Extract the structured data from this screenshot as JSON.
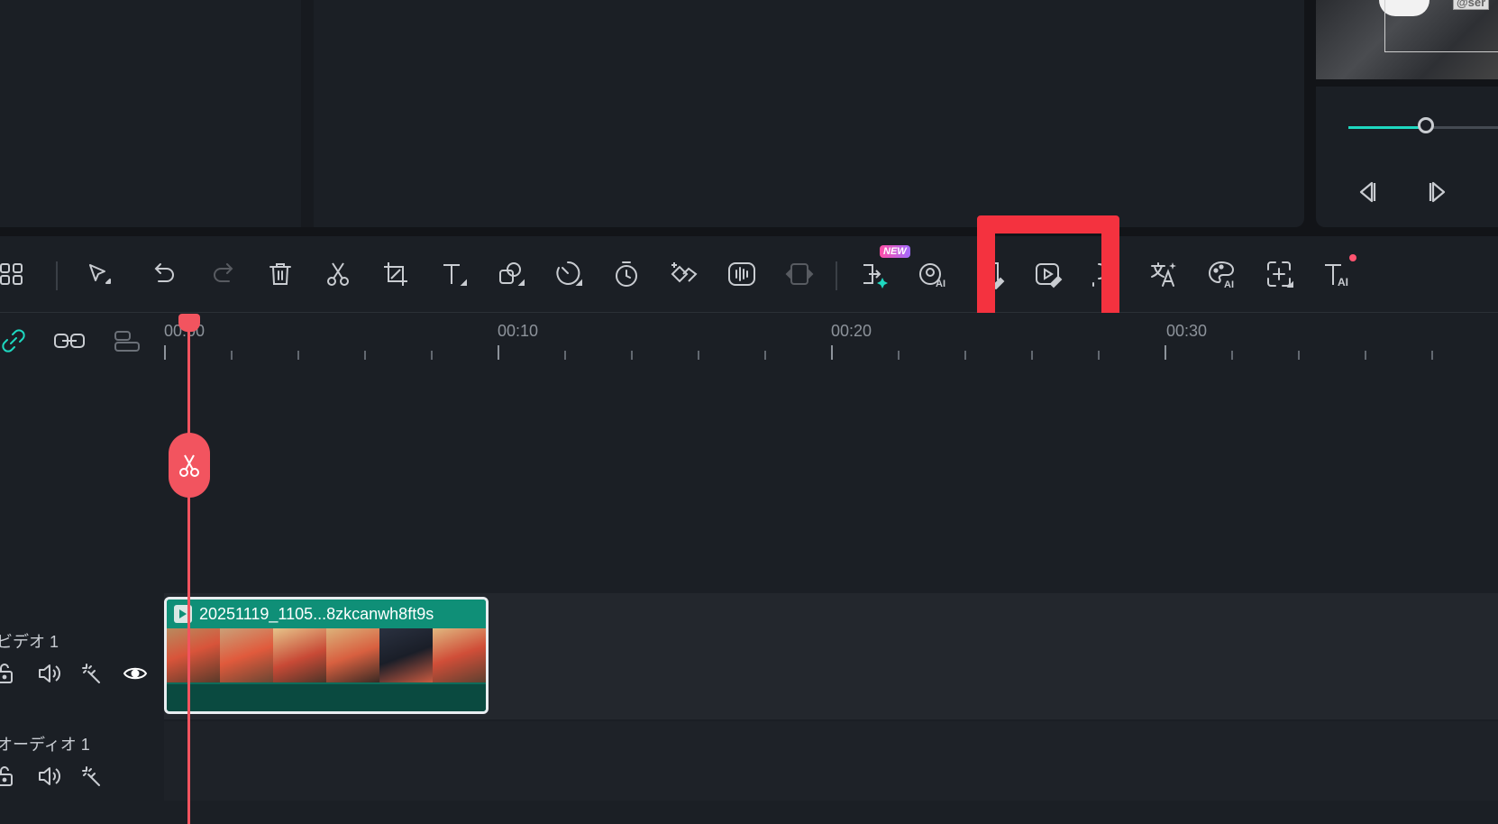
{
  "preview": {
    "watermark": "@ser",
    "slider_level": 0.52
  },
  "toolbar": {
    "new_badge": "NEW",
    "tools": [
      "layout-grid-icon",
      "select-arrow-icon",
      "undo-icon",
      "redo-icon",
      "delete-icon",
      "split-scissors-icon",
      "crop-icon",
      "text-icon",
      "shape-icon",
      "speed-icon",
      "timer-icon",
      "keyframe-icon",
      "audio-waveform-icon",
      "freeze-frame-icon",
      "ai-split-icon",
      "ai-portrait-icon",
      "ai-edit-icon",
      "ai-video-edit-icon",
      "ai-voice-icon",
      "translate-icon",
      "ai-color-palette-icon",
      "add-frame-icon",
      "ai-text-icon"
    ],
    "highlight_color": "#f4323f"
  },
  "timeline": {
    "ruler": [
      "00:00",
      "00:10",
      "00:20",
      "00:30"
    ],
    "tracks": {
      "video_label": "ビデオ 1",
      "audio_label": "オーディオ 1"
    },
    "clip": {
      "title": "20251119_1105...8zkcanwh8ft9s"
    },
    "playhead_color": "#f2545f",
    "accent": "#1ed8c0"
  }
}
